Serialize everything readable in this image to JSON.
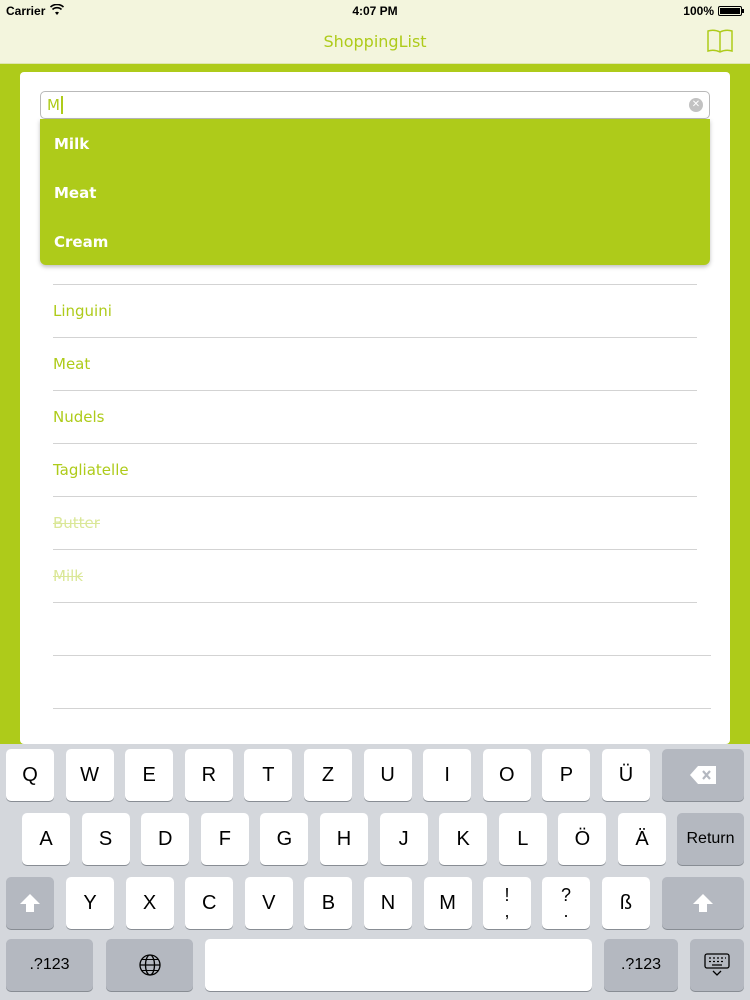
{
  "status_bar": {
    "carrier": "Carrier",
    "time": "4:07 PM",
    "battery": "100%",
    "battery_level": 1.0
  },
  "nav": {
    "title": "ShoppingList",
    "right_icon": "book-icon"
  },
  "search": {
    "value": "M",
    "clear_icon": "clear-icon"
  },
  "suggestions": [
    {
      "label": "Milk"
    },
    {
      "label": "Meat"
    },
    {
      "label": "Cream"
    }
  ],
  "items": [
    {
      "label": "",
      "done": false
    },
    {
      "label": "Linguini",
      "done": false
    },
    {
      "label": "Meat",
      "done": false
    },
    {
      "label": "Nudels",
      "done": false
    },
    {
      "label": "Tagliatelle",
      "done": false
    },
    {
      "label": "Butter",
      "done": true
    },
    {
      "label": "Milk",
      "done": true
    },
    {
      "label": "",
      "done": false
    },
    {
      "label": "",
      "done": false
    }
  ],
  "keyboard": {
    "row1": [
      "Q",
      "W",
      "E",
      "R",
      "T",
      "Z",
      "U",
      "I",
      "O",
      "P",
      "Ü"
    ],
    "row2": [
      "A",
      "S",
      "D",
      "F",
      "G",
      "H",
      "J",
      "K",
      "L",
      "Ö",
      "Ä"
    ],
    "row3": [
      "Y",
      "X",
      "C",
      "V",
      "B",
      "N",
      "M"
    ],
    "punct1": [
      "!",
      ","
    ],
    "punct2": [
      "?",
      "."
    ],
    "sz": "ß",
    "return_label": "Return",
    "numbers_left": ".?123",
    "numbers_right": ".?123",
    "space_label": ""
  },
  "colors": {
    "accent": "#aecb1a",
    "bar_bg": "#f3f5dd",
    "keyboard_bg": "#d4d7dc"
  }
}
